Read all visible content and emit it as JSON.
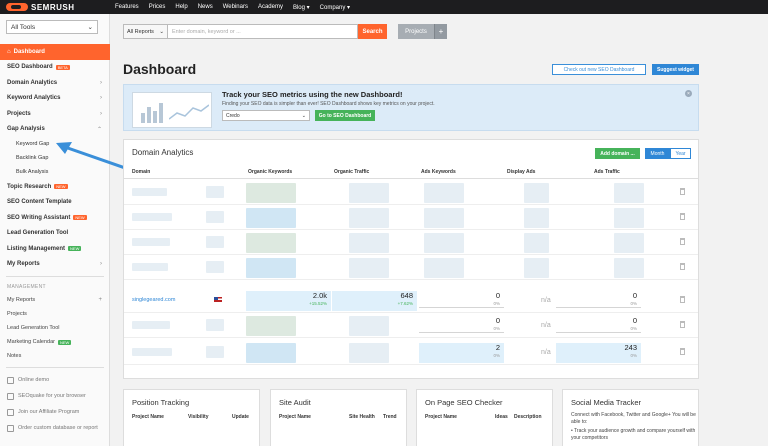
{
  "brand": {
    "name": "SEMRUSH",
    "accent": "#ff642d"
  },
  "topnav": [
    "Features",
    "Prices",
    "Help",
    "News",
    "Webinars",
    "Academy",
    "Blog ▾",
    "Company ▾"
  ],
  "sidebar": {
    "tools_select": "All Tools",
    "items": [
      {
        "label": "Dashboard",
        "active": true
      },
      {
        "label": "SEO Dashboard",
        "badge": "BETA"
      },
      {
        "label": "Domain Analytics",
        "chevron": "›"
      },
      {
        "label": "Keyword Analytics",
        "chevron": "›"
      },
      {
        "label": "Projects",
        "chevron": "›"
      },
      {
        "label": "Gap Analysis",
        "chevron": "⌃"
      },
      {
        "label": "Keyword Gap",
        "sub": true
      },
      {
        "label": "Backlink Gap",
        "sub": true
      },
      {
        "label": "Bulk Analysis",
        "sub": true
      },
      {
        "label": "Topic Research",
        "badge": "NEW"
      },
      {
        "label": "SEO Content Template"
      },
      {
        "label": "SEO Writing Assistant",
        "badge": "NEW"
      },
      {
        "label": "Lead Generation Tool"
      },
      {
        "label": "Listing Management",
        "badge": "NEW",
        "badge_green": true
      },
      {
        "label": "My Reports",
        "chevron": "›"
      }
    ],
    "management_title": "MANAGEMENT",
    "management": [
      {
        "label": "My Reports",
        "plus": "+"
      },
      {
        "label": "Projects"
      },
      {
        "label": "Lead Generation Tool"
      },
      {
        "label": "Marketing Calendar",
        "badge": "NEW"
      },
      {
        "label": "Notes"
      }
    ],
    "bottom": [
      "Online demo",
      "SEOquake for your browser",
      "Join our Affiliate Program",
      "Order custom database or report"
    ]
  },
  "search": {
    "select": "All Reports",
    "placeholder": "Enter domain, keyword or ...",
    "button": "Search",
    "projects": "Projects",
    "plus": "+"
  },
  "page": {
    "title": "Dashboard",
    "check_out": "Check out new SEO Dashboard",
    "suggest": "Suggest widget"
  },
  "banner": {
    "title": "Track your SEO metrics using the new Dashboard!",
    "text": "Finding your SEO data is simpler than ever! SEO Dashboard shows key metrics on your project.",
    "select": "Credo",
    "button": "Go to SEO Dashboard",
    "close": "×"
  },
  "domain_analytics": {
    "title": "Domain Analytics",
    "add": "Add domain ...",
    "month": "Month",
    "year": "Year",
    "columns": [
      "Domain",
      "Organic Keywords",
      "Organic Traffic",
      "Ads Keywords",
      "Display Ads",
      "Ads Traffic"
    ],
    "visible_row": {
      "domain": "singlegeared.com",
      "organic_keywords": "2.0k",
      "organic_keywords_change": "+15.52%",
      "organic_traffic": "648",
      "organic_traffic_change": "+7.62%",
      "ads_keywords": "0",
      "ads_keywords_change": "0%",
      "display_ads": "n/a",
      "ads_traffic": "0",
      "ads_traffic_change": "0%"
    },
    "row6": {
      "ads_keywords": "0",
      "ads_keywords_change": "0%",
      "display_ads": "n/a",
      "ads_traffic": "0",
      "ads_traffic_change": "0%"
    },
    "row7": {
      "ads_keywords": "2",
      "ads_keywords_change": "0%",
      "display_ads": "n/a",
      "ads_traffic": "243",
      "ads_traffic_change": "0%"
    }
  },
  "bottom_widgets": [
    {
      "title": "Position Tracking",
      "cols": [
        "Project Name",
        "Visibility",
        "Update"
      ]
    },
    {
      "title": "Site Audit",
      "cols": [
        "Project Name",
        "Site Health",
        "Trend"
      ]
    },
    {
      "title": "On Page SEO Checker",
      "cols": [
        "Project Name",
        "Ideas",
        "Description"
      ]
    },
    {
      "title": "Social Media Tracker",
      "text": "Connect with Facebook, Twitter and Google+ You will be able to:",
      "bullet": "•  Track your audience growth and compare yourself with your competitors"
    }
  ]
}
